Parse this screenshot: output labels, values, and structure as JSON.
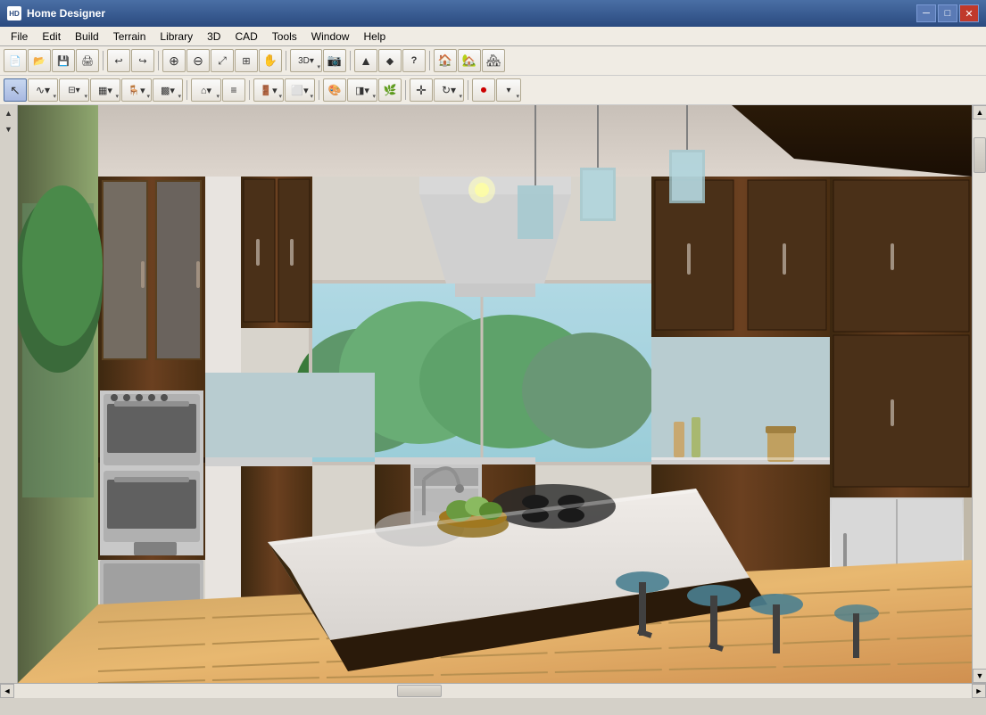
{
  "app": {
    "title": "Home Designer",
    "icon_label": "HD"
  },
  "title_controls": {
    "minimize": "─",
    "maximize": "□",
    "close": "✕"
  },
  "menu": {
    "items": [
      "File",
      "Edit",
      "Build",
      "Terrain",
      "Library",
      "3D",
      "CAD",
      "Tools",
      "Window",
      "Help"
    ]
  },
  "toolbar1": {
    "buttons": [
      {
        "name": "new",
        "icon": "📄",
        "label": "New"
      },
      {
        "name": "open",
        "icon": "📂",
        "label": "Open"
      },
      {
        "name": "save",
        "icon": "💾",
        "label": "Save"
      },
      {
        "name": "print",
        "icon": "🖨",
        "label": "Print"
      },
      {
        "name": "undo",
        "icon": "↩",
        "label": "Undo"
      },
      {
        "name": "redo",
        "icon": "↪",
        "label": "Redo"
      },
      {
        "name": "zoom-in",
        "icon": "⊕",
        "label": "Zoom In"
      },
      {
        "name": "zoom-out",
        "icon": "⊖",
        "label": "Zoom Out"
      },
      {
        "name": "zoom-fit",
        "icon": "⤢",
        "label": "Zoom Fit"
      },
      {
        "name": "pan",
        "icon": "✋",
        "label": "Pan"
      },
      {
        "name": "select",
        "icon": "↖",
        "label": "Select"
      },
      {
        "name": "up-arrow",
        "icon": "▲",
        "label": "Up"
      },
      {
        "name": "marker",
        "icon": "◆",
        "label": "Marker"
      },
      {
        "name": "question",
        "icon": "?",
        "label": "Help"
      },
      {
        "name": "house1",
        "icon": "🏠",
        "label": "House View 1"
      },
      {
        "name": "house2",
        "icon": "🏡",
        "label": "House View 2"
      },
      {
        "name": "house3",
        "icon": "🏘",
        "label": "House View 3"
      }
    ]
  },
  "toolbar2": {
    "buttons": [
      {
        "name": "select-tool",
        "icon": "↖",
        "label": "Select"
      },
      {
        "name": "spline",
        "icon": "∿",
        "label": "Spline"
      },
      {
        "name": "wall",
        "icon": "▬",
        "label": "Wall"
      },
      {
        "name": "cabinet",
        "icon": "▦",
        "label": "Cabinet"
      },
      {
        "name": "furniture",
        "icon": "🪑",
        "label": "Furniture"
      },
      {
        "name": "floor",
        "icon": "▩",
        "label": "Floor"
      },
      {
        "name": "roof",
        "icon": "⌂",
        "label": "Roof"
      },
      {
        "name": "stair",
        "icon": "≡",
        "label": "Stair"
      },
      {
        "name": "door",
        "icon": "🚪",
        "label": "Door"
      },
      {
        "name": "window-tool",
        "icon": "⬜",
        "label": "Window"
      },
      {
        "name": "paint",
        "icon": "🎨",
        "label": "Paint"
      },
      {
        "name": "material",
        "icon": "◨",
        "label": "Material"
      },
      {
        "name": "plant",
        "icon": "🌿",
        "label": "Plant"
      },
      {
        "name": "move",
        "icon": "✛",
        "label": "Move"
      },
      {
        "name": "rotate",
        "icon": "↻",
        "label": "Rotate"
      },
      {
        "name": "record",
        "icon": "⏺",
        "label": "Record"
      }
    ]
  },
  "status": {
    "text": ""
  },
  "scene": {
    "description": "3D kitchen render with dark wood cabinets, white island, bar stools, stainless appliances"
  }
}
